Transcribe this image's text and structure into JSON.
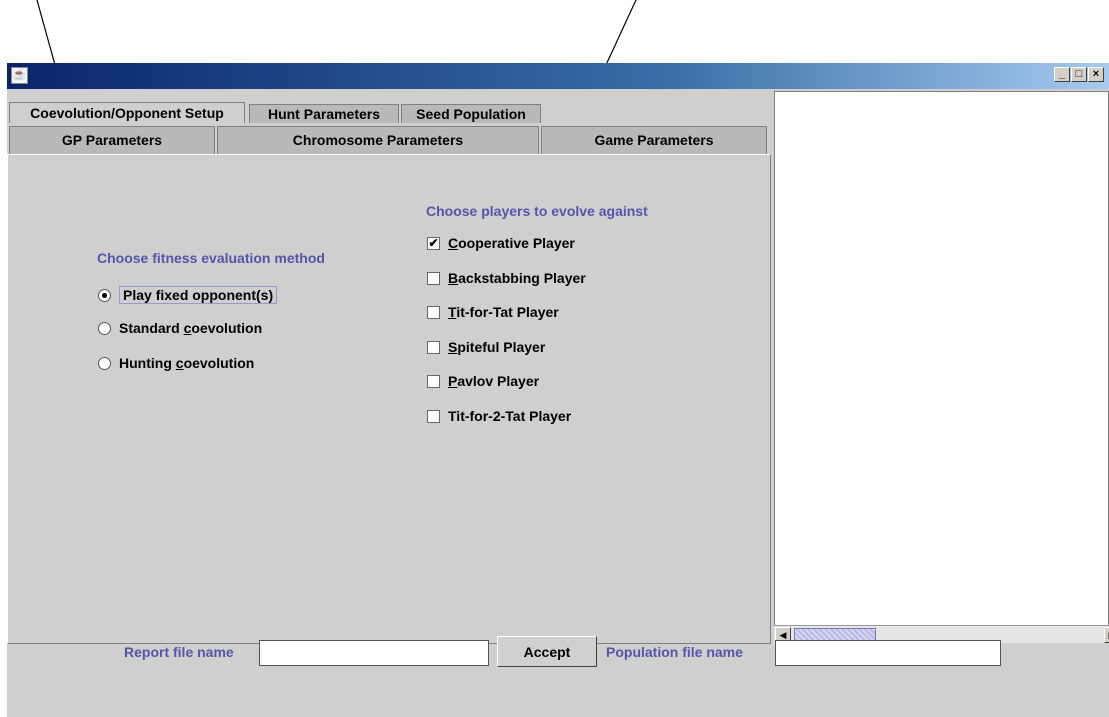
{
  "tabs_row1": [
    {
      "label": "Coevolution/Opponent Setup",
      "active": true
    },
    {
      "label": "Hunt Parameters",
      "active": false
    },
    {
      "label": "Seed Population",
      "active": false
    }
  ],
  "tabs_row2": [
    {
      "label": "GP Parameters"
    },
    {
      "label": "Chromosome Parameters"
    },
    {
      "label": "Game Parameters"
    }
  ],
  "fitness": {
    "heading": "Choose fitness evaluation method",
    "options": [
      {
        "label": "Play fixed opponent(s)",
        "selected": true
      },
      {
        "label": "Standard coevolution",
        "selected": false
      },
      {
        "label": "Hunting coevolution",
        "selected": false
      }
    ]
  },
  "players": {
    "heading": "Choose players to evolve against",
    "options": [
      {
        "label": "Cooperative Player",
        "checked": true
      },
      {
        "label": "Backstabbing Player",
        "checked": false
      },
      {
        "label": "Tit-for-Tat Player",
        "checked": false
      },
      {
        "label": "Spiteful Player",
        "checked": false
      },
      {
        "label": "Pavlov Player",
        "checked": false
      },
      {
        "label": "Tit-for-2-Tat Player",
        "checked": false
      }
    ]
  },
  "bottom": {
    "report_label": "Report file name",
    "report_value": "",
    "accept_label": "Accept",
    "population_label": "Population file name",
    "population_value": ""
  },
  "icons": {
    "app_icon": "java-cup-icon",
    "minimize": "minimize-icon",
    "maximize": "maximize-icon",
    "close": "close-icon"
  },
  "colors": {
    "title_bar_start": "#0a246a",
    "title_bar_end": "#a6caf0",
    "heading_text": "#5555aa",
    "panel_bg": "#cfcfcf"
  }
}
